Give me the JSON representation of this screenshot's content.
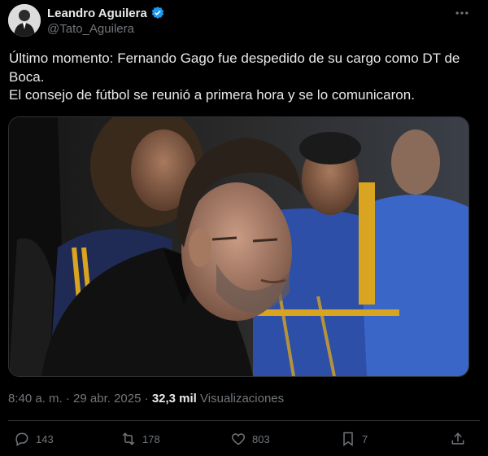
{
  "author": {
    "name": "Leandro Aguilera",
    "handle": "@Tato_Aguilera",
    "verified_color": "#1d9bf0"
  },
  "tweet": {
    "lines": [
      "Último momento: Fernando Gago fue despedido de su cargo como DT de Boca.",
      "El consejo de fútbol se reunió a primera hora y se lo comunicaron."
    ]
  },
  "meta": {
    "time": "8:40 a. m.",
    "separator": "·",
    "date": "29 abr. 2025",
    "views_count": "32,3 mil",
    "views_label": "Visualizaciones"
  },
  "actions": {
    "replies": "143",
    "reposts": "178",
    "likes": "803",
    "bookmarks": "7"
  },
  "icons": [
    "avatar",
    "verified-badge-icon",
    "more-options-icon",
    "reply-icon",
    "repost-icon",
    "like-icon",
    "bookmark-icon",
    "share-icon"
  ]
}
